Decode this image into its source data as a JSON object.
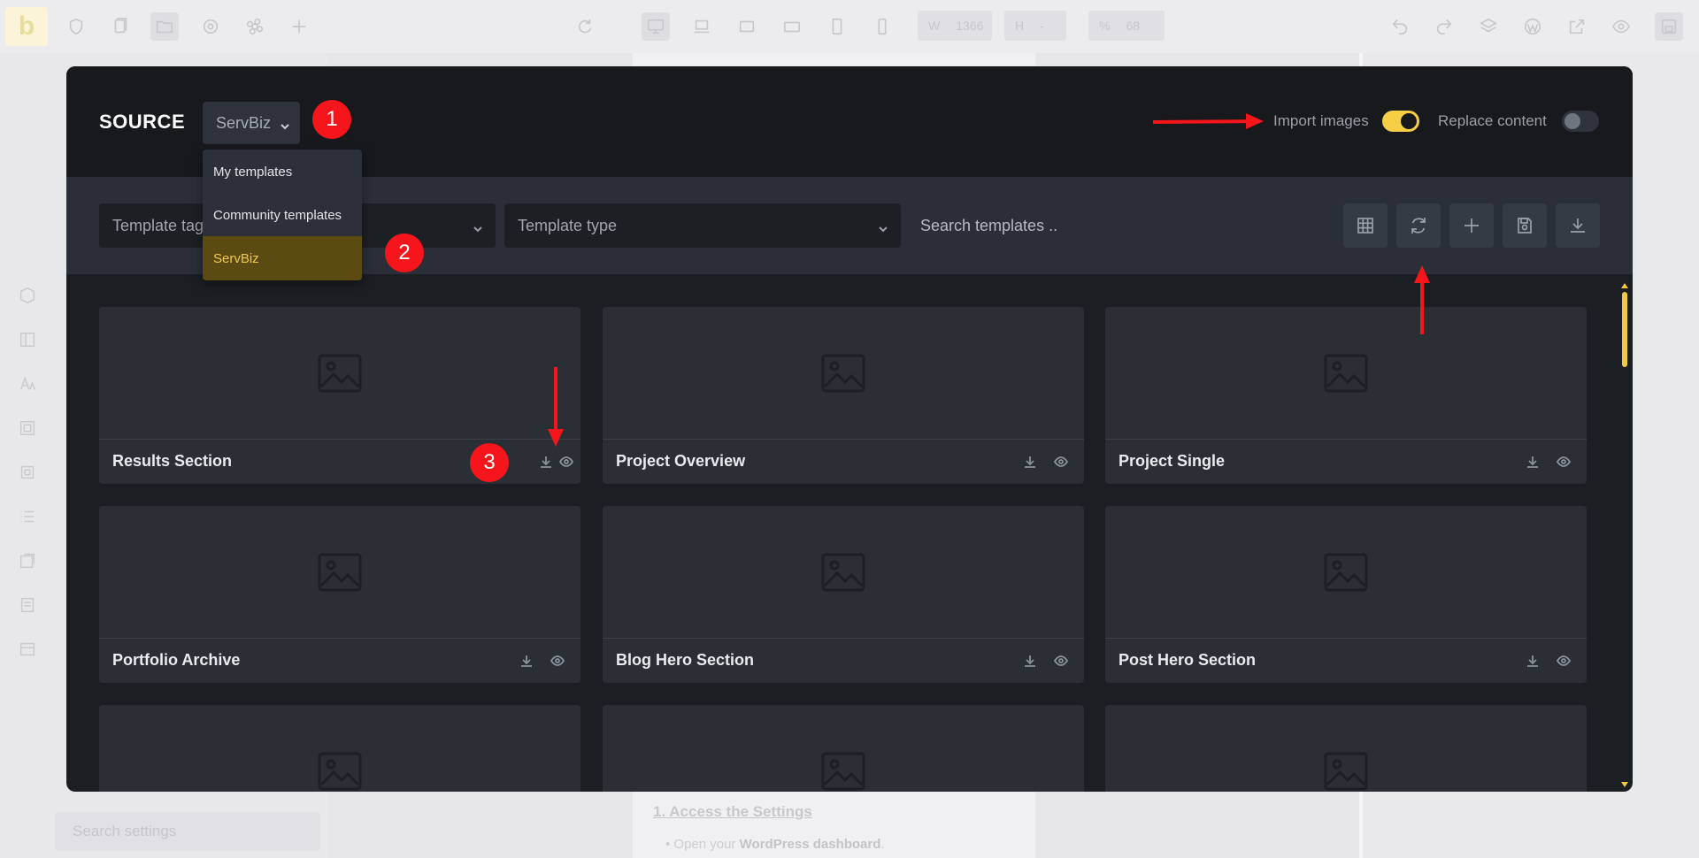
{
  "background": {
    "topbar": {
      "logo": "b",
      "width_label": "W",
      "width_value": "1366",
      "height_label": "H",
      "height_value": "-",
      "zoom_label": "%",
      "zoom_value": "68"
    },
    "sidebar": {
      "search_placeholder": "Search settings"
    },
    "canvas": {
      "heading": "1. Access the Settings",
      "bullet_prefix": "Open your ",
      "bullet_bold": "WordPress dashboard",
      "bullet_suffix": "."
    }
  },
  "modal": {
    "source_label": "SOURCE",
    "source_selected": "ServBiz",
    "source_options": [
      "My templates",
      "Community templates",
      "ServBiz"
    ],
    "import_images_label": "Import images",
    "import_images_on": true,
    "replace_content_label": "Replace content",
    "replace_content_on": false,
    "filters": {
      "template_tags_placeholder": "Template tags",
      "template_type_placeholder": "Template type",
      "search_placeholder": "Search templates .."
    },
    "toolbar_icons": [
      "grid-icon",
      "refresh-icon",
      "plus-icon",
      "save-icon",
      "download-icon"
    ],
    "templates": [
      {
        "title": "Results Section"
      },
      {
        "title": "Project Overview"
      },
      {
        "title": "Project Single"
      },
      {
        "title": "Portfolio Archive"
      },
      {
        "title": "Blog Hero Section"
      },
      {
        "title": "Post Hero Section"
      },
      {
        "title": ""
      },
      {
        "title": ""
      },
      {
        "title": ""
      }
    ]
  },
  "annotations": {
    "badges": [
      "1",
      "2",
      "3"
    ]
  },
  "colors": {
    "accent": "#f7cf47",
    "annotation_red": "#f5151a",
    "modal_bg": "#1b1e22",
    "card_bg": "#2a2e35"
  }
}
